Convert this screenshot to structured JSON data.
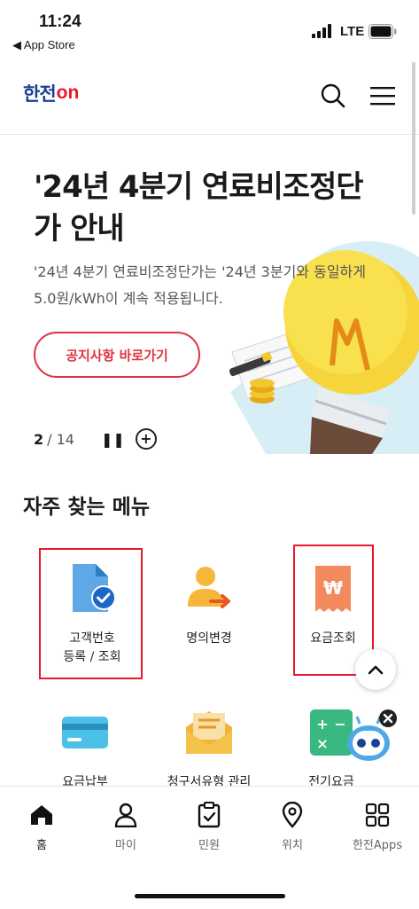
{
  "status_bar": {
    "time": "11:24",
    "back_label": "◀ App Store",
    "network": "LTE"
  },
  "header": {
    "logo_part1": "한전",
    "logo_part2": "on"
  },
  "banner": {
    "title": "'24년 4분기 연료비조정단가 안내",
    "description": "'24년 4분기 연료비조정단가는 '24년 3분기와 동일하게 5.0원/kWh이 계속 적용됩니다.",
    "button_label": "공지사항 바로가기",
    "page_current": "2",
    "page_total": "/ 14"
  },
  "frequent_menu": {
    "title": "자주 찾는 메뉴",
    "items": [
      {
        "label": "고객번호\n등록 / 조회"
      },
      {
        "label": "명의변경"
      },
      {
        "label": "요금조회"
      },
      {
        "label": "요금납부"
      },
      {
        "label": "청구서유형 관리"
      },
      {
        "label": "전기요금"
      }
    ]
  },
  "tabs": [
    {
      "label": "홈",
      "icon": "home-icon"
    },
    {
      "label": "마이",
      "icon": "person-icon"
    },
    {
      "label": "민원",
      "icon": "clipboard-icon"
    },
    {
      "label": "위치",
      "icon": "location-icon"
    },
    {
      "label": "한전Apps",
      "icon": "apps-grid-icon"
    }
  ],
  "colors": {
    "brand_blue": "#1d3f94",
    "brand_red": "#e8192c",
    "highlight_box": "#e8192c"
  }
}
